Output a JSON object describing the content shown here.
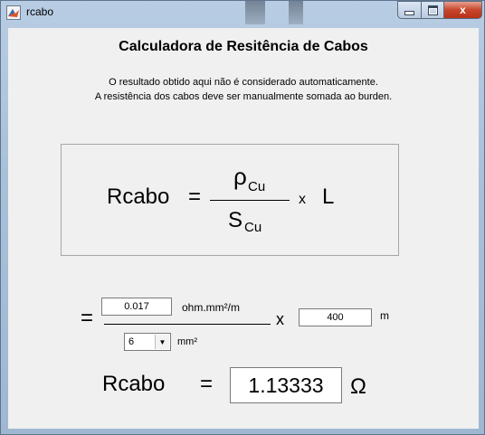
{
  "window": {
    "title": "rcabo",
    "controls": {
      "minimize": "minimize",
      "maximize": "maximize",
      "close": "x"
    }
  },
  "header": {
    "title": "Calculadora de Resitência de Cabos",
    "note_line1": "O resultado obtido aqui não é considerado automaticamente.",
    "note_line2": "A resistência dos cabos deve ser manualmente somada ao burden."
  },
  "formula": {
    "lhs": "Rcabo",
    "equals": "=",
    "numerator_symbol": "ρ",
    "numerator_sub": "Cu",
    "denominator_symbol": "S",
    "denominator_sub": "Cu",
    "times": "x",
    "length_symbol": "L"
  },
  "calc": {
    "equals": "=",
    "resistivity_value": "0.017",
    "resistivity_unit": "ohm.mm²/m",
    "times": "x",
    "length_value": "400",
    "length_unit": "m",
    "section_value": "6",
    "section_unit": "mm²"
  },
  "result": {
    "label": "Rcabo",
    "equals": "=",
    "value": "1.13333",
    "unit": "Ω"
  }
}
